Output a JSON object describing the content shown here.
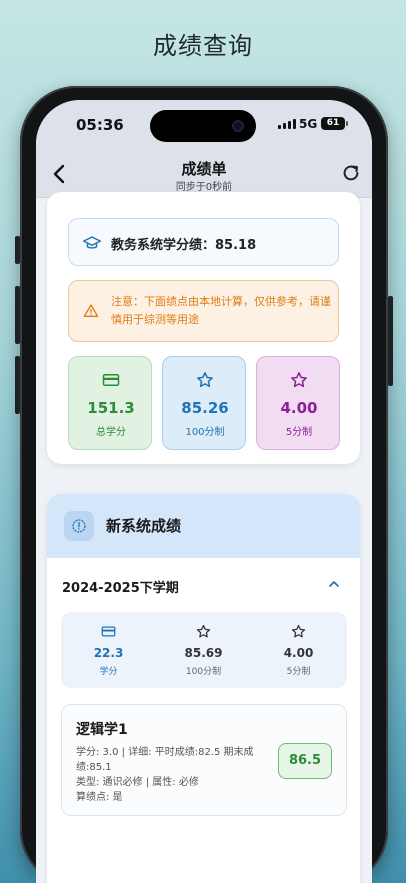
{
  "page": {
    "title": "成绩查询"
  },
  "status_bar": {
    "time": "05:36",
    "network": "5G",
    "battery": "61"
  },
  "nav": {
    "title": "成绩单",
    "subtitle": "同步于0秒前",
    "back_icon": "chevron-left-icon",
    "refresh_icon": "refresh-icon"
  },
  "summary": {
    "gpa_text": "教务系统学分绩：85.18",
    "notice": "注意：下面绩点由本地计算，仅供参考，请谨慎用于综测等用途",
    "stats": [
      {
        "value": "151.3",
        "label": "总学分",
        "icon": "credit-card-icon",
        "color": "#2e8b3a"
      },
      {
        "value": "85.26",
        "label": "100分制",
        "icon": "star-icon",
        "color": "#1f74b5"
      },
      {
        "value": "4.00",
        "label": "5分制",
        "icon": "star-icon",
        "color": "#8a2296"
      }
    ]
  },
  "system": {
    "title": "新系统成绩",
    "term": "2024-2025下学期",
    "term_stats": [
      {
        "value": "22.3",
        "label": "学分",
        "color": "#1f74b5"
      },
      {
        "value": "85.69",
        "label": "100分制",
        "color": "#333333"
      },
      {
        "value": "4.00",
        "label": "5分制",
        "color": "#333333"
      }
    ],
    "courses": [
      {
        "name": "逻辑学1",
        "detail1": "学分: 3.0 | 详细: 平时成绩:82.5 期末成绩:85.1",
        "detail2": "类型: 通识必修 | 属性: 必修",
        "detail3": "算绩点: 是",
        "score": "86.5"
      }
    ]
  }
}
